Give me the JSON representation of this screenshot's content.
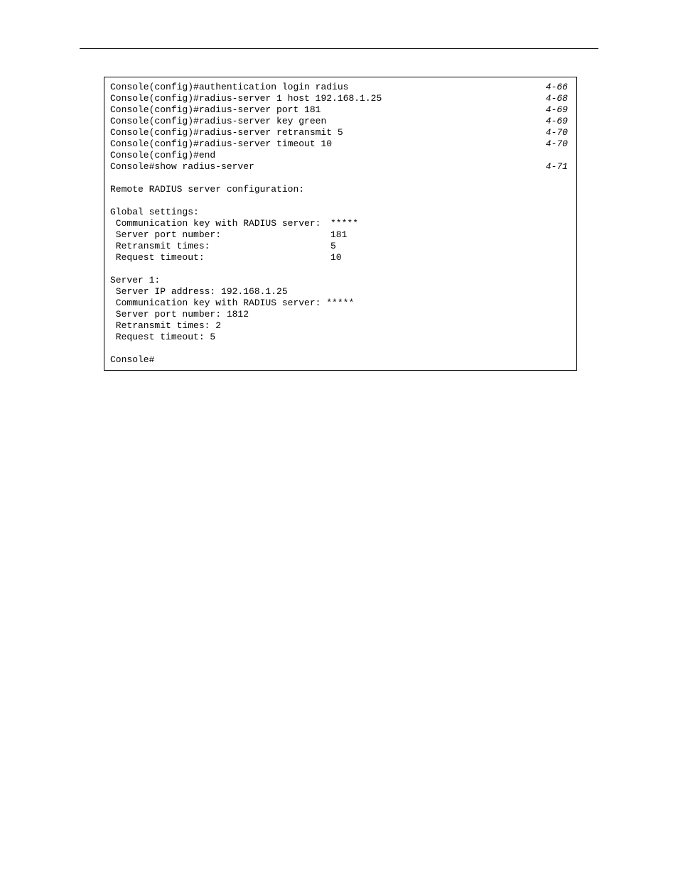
{
  "lines": [
    {
      "cmd": "Console(config)#authentication login radius",
      "ref": "4-66"
    },
    {
      "cmd": "Console(config)#radius-server 1 host 192.168.1.25",
      "ref": "4-68"
    },
    {
      "cmd": "Console(config)#radius-server port 181",
      "ref": "4-69"
    },
    {
      "cmd": "Console(config)#radius-server key green",
      "ref": "4-69"
    },
    {
      "cmd": "Console(config)#radius-server retransmit 5",
      "ref": "4-70"
    },
    {
      "cmd": "Console(config)#radius-server timeout 10",
      "ref": "4-70"
    },
    {
      "cmd": "Console(config)#end",
      "ref": ""
    },
    {
      "cmd": "Console#show radius-server",
      "ref": "4-71"
    }
  ],
  "blank1": " ",
  "section1": "Remote RADIUS server configuration:",
  "blank2": " ",
  "global_header": "Global settings:",
  "global": [
    {
      "k": " Communication key with RADIUS server:",
      "v": "*****"
    },
    {
      "k": " Server port number:",
      "v": "181"
    },
    {
      "k": " Retransmit times:",
      "v": "5"
    },
    {
      "k": " Request timeout:",
      "v": "10"
    }
  ],
  "blank3": " ",
  "server1_header": "Server 1:",
  "server1": [
    " Server IP address: 192.168.1.25",
    " Communication key with RADIUS server: *****",
    " Server port number: 1812",
    " Retransmit times: 2",
    " Request timeout: 5"
  ],
  "blank4": " ",
  "prompt": "Console#"
}
